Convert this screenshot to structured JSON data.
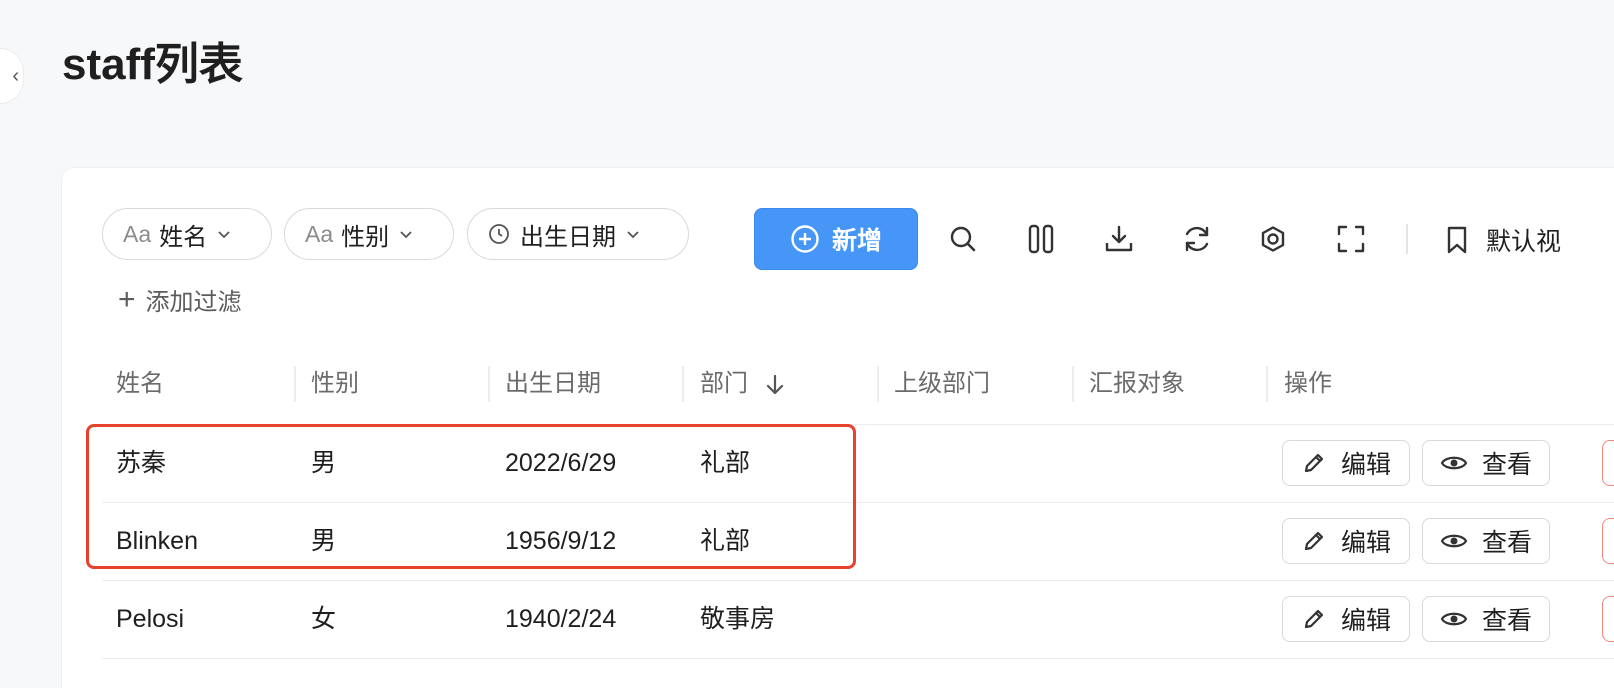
{
  "page": {
    "title": "staff列表"
  },
  "filters": {
    "name": {
      "prefix": "Aa",
      "label": "姓名"
    },
    "gender": {
      "prefix": "Aa",
      "label": "性别"
    },
    "birthdate": {
      "label": "出生日期"
    },
    "add_filter": "添加过滤"
  },
  "toolbar": {
    "new_label": "新增",
    "view_label": "默认视",
    "icons": [
      "search-icon",
      "columns-icon",
      "download-icon",
      "refresh-icon",
      "settings-icon",
      "fullscreen-icon",
      "bookmark-icon"
    ]
  },
  "table": {
    "headers": [
      "姓名",
      "性别",
      "出生日期",
      "部门",
      "上级部门",
      "汇报对象",
      "操作"
    ],
    "sorted_column": "部门",
    "rows": [
      {
        "name": "苏秦",
        "gender": "男",
        "birthdate": "2022/6/29",
        "dept": "礼部",
        "parent_dept": "",
        "report_to": ""
      },
      {
        "name": "Blinken",
        "gender": "男",
        "birthdate": "1956/9/12",
        "dept": "礼部",
        "parent_dept": "",
        "report_to": ""
      },
      {
        "name": "Pelosi",
        "gender": "女",
        "birthdate": "1940/2/24",
        "dept": "敬事房",
        "parent_dept": "",
        "report_to": ""
      }
    ],
    "actions": {
      "edit": "编辑",
      "view": "查看"
    }
  },
  "colors": {
    "primary": "#4596f7",
    "highlight": "#e8412e",
    "danger_border": "#f08a80"
  }
}
